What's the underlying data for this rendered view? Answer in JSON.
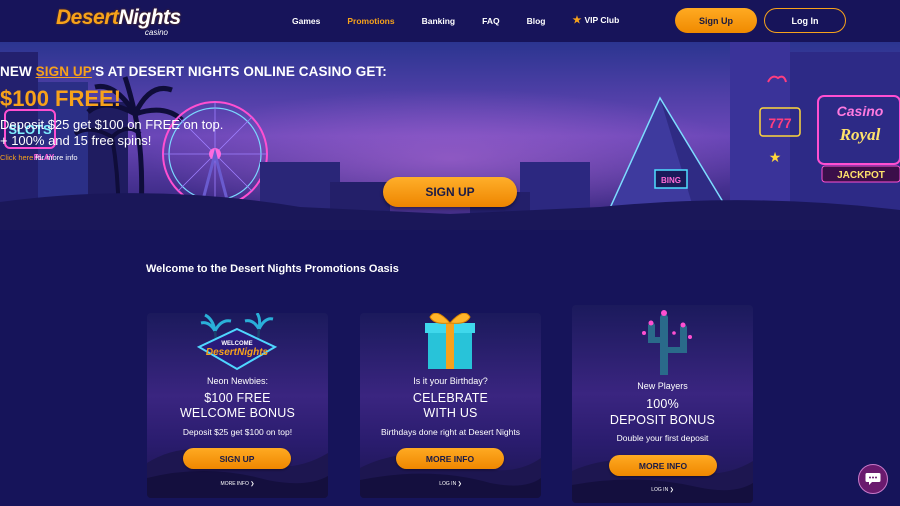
{
  "header": {
    "logo_main_a": "Desert",
    "logo_main_b": "Nights",
    "logo_sub": "casino",
    "nav": [
      "Games",
      "Promotions",
      "Banking",
      "FAQ",
      "Blog",
      "VIP Club"
    ],
    "active_nav": "Promotions",
    "signup_label": "Sign Up",
    "login_label": "Log In"
  },
  "hero": {
    "line1_pre": "NEW ",
    "line1_link": "SIGN UP",
    "line1_post": "'S AT DESERT NIGHTS ONLINE CASINO GET:",
    "headline": "$100 FREE!",
    "line3": "Deposit $25 get $100 on FREE on top.",
    "line4": "+ 100% and 15 free spins!",
    "more_link": "Click here",
    "more_text": " for more info",
    "cta_label": "SIGN UP",
    "sign_slots": "SLOTS",
    "sign_play": "PLAY",
    "sign_casino": "Casino",
    "sign_royal": "Royal",
    "sign_jackpot": "JACKPOT",
    "sign_777": "777",
    "sign_bingo": "BING"
  },
  "section": {
    "title": "Welcome to the Desert Nights Promotions Oasis"
  },
  "cards": [
    {
      "badge_top": "WELCOME",
      "badge_main": "DesertNights",
      "eyebrow": "Neon Newbies:",
      "title_line1": "$100 FREE",
      "title_line2": "WELCOME BONUS",
      "sub": "Deposit $25 get $100 on top!",
      "button": "SIGN UP",
      "link": "MORE INFO ❯"
    },
    {
      "eyebrow": "Is it your Birthday?",
      "title_line1": "CELEBRATE",
      "title_line2": "WITH US",
      "sub": "Birthdays done right at Desert Nights",
      "button": "MORE INFO",
      "link": "LOG IN ❯"
    },
    {
      "eyebrow": "New Players",
      "title_line1": "100%",
      "title_line2": "DEPOSIT BONUS",
      "sub": "Double your first deposit",
      "button": "MORE INFO",
      "link": "LOG IN ❯"
    }
  ],
  "icons": [
    "star-icon",
    "chat-icon",
    "ferris-wheel-icon",
    "palm-tree-icon",
    "gift-icon",
    "cactus-icon"
  ],
  "colors": {
    "accent": "#f7a21b",
    "bg": "#16145a",
    "chat": "#6a1a6e"
  }
}
